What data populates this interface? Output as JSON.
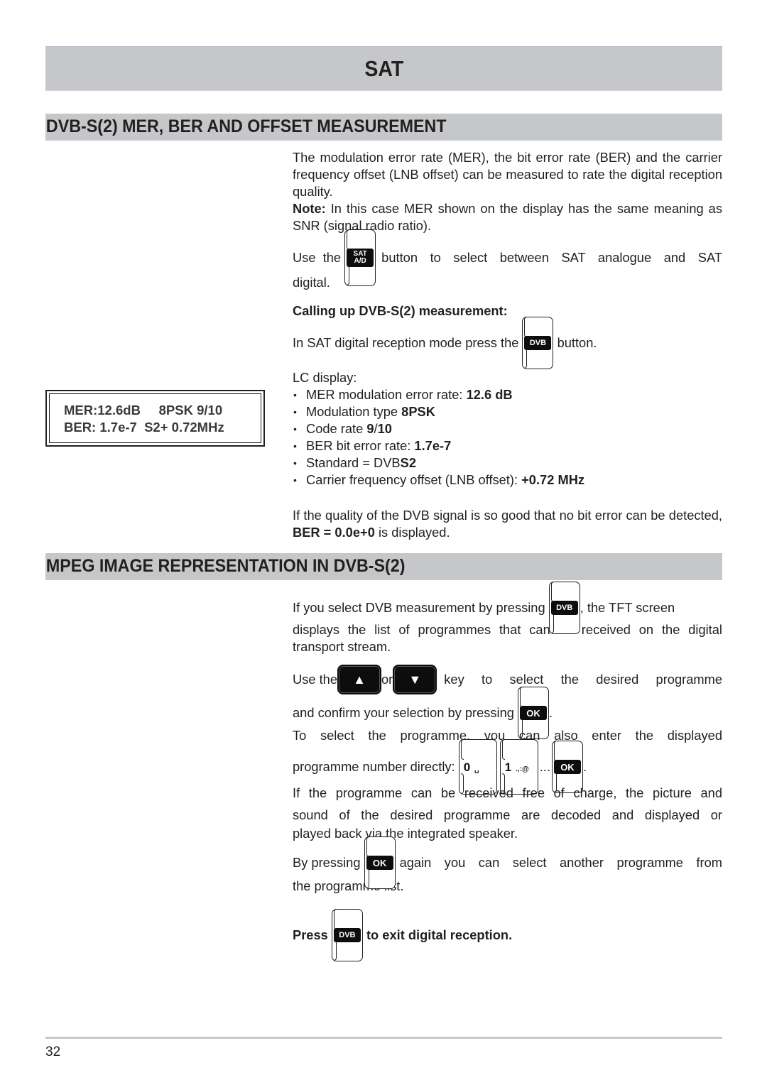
{
  "chapter": {
    "title": "SAT"
  },
  "section1": {
    "title": "DVB-S(2) MER, BER AND OFFSET MEASUREMENT",
    "intro": "The modulation error rate (MER), the bit error rate (BER) and the carrier frequency offset (LNB offset) can be measured to rate the digital reception quality.",
    "note_label": "Note:",
    "note_text": " In this case MER shown on the display has the same meaning as SNR (signal radio ratio).",
    "use_before": "Use the ",
    "use_after": " button to select between SAT analogue and SAT digital.",
    "calling_heading": "Calling up DVB-S(2) measurement:",
    "press_before": "In SAT digital reception mode press the ",
    "press_after": " button.",
    "lc_label": "LC display:",
    "bullets": [
      {
        "text": "MER modulation error rate: ",
        "bold": "12.6 dB",
        "tail": ""
      },
      {
        "text": "Modulation type ",
        "bold": "8PSK",
        "tail": ""
      },
      {
        "text": "Code rate ",
        "bold": "9",
        "tail": "/",
        "bold2": "10"
      },
      {
        "text": "BER bit error rate: ",
        "bold": "1.7e-7",
        "tail": ""
      },
      {
        "text": "Standard = DVB",
        "bold": "S2",
        "tail": ""
      },
      {
        "text": "Carrier frequency offset (LNB offset): ",
        "bold": "+0.72 MHz",
        "tail": ""
      }
    ],
    "no_error_before": "If the quality of the DVB signal is so good that no bit error can be detected, ",
    "no_error_bold": "BER = 0.0e+0",
    "no_error_after": " is displayed."
  },
  "lcd": {
    "row1": "MER:12.6dB     8PSK 9/10",
    "row2": "BER: 1.7e-7  S2+ 0.72MHz"
  },
  "section2": {
    "title": "MPEG IMAGE REPRESENTATION IN DVB-S(2)",
    "p1_before": "If you select DVB measurement by pressing ",
    "p1_after": ", the TFT screen",
    "p1_line2": "displays the list of programmes that can be received on the digital",
    "p1_line3": "transport stream.",
    "p2_use": "Use the",
    "p2_or": "or",
    "p2_after": "key to select the desired programme",
    "p2_confirm": "and confirm your selection by pressing ",
    "p2_end": ".",
    "p3_line1": "To select the programme, you can also enter the displayed",
    "p3_before": "programme number directly: ",
    "p3_ellipsis": "...",
    "p3_end": ".",
    "p4_line1": "If the programme can be received free of charge, the picture and",
    "p4_line2": "sound of the desired programme are decoded and displayed or",
    "p4_line3": "played back via the integrated speaker.",
    "p5_before": "By pressing ",
    "p5_after": " again you can select another programme from",
    "p5_line2": "the programme list.",
    "p6_before": "Press ",
    "p6_after": " to exit digital reception."
  },
  "keys": {
    "sat_line1": "SAT",
    "sat_line2": "A/D",
    "dvb": "DVB",
    "ok": "OK",
    "up": "▲",
    "down": "▼",
    "zero": "0",
    "zero_sub": "␣",
    "one": "1",
    "one_sub": ".,:@"
  },
  "footer": {
    "page_number": "32"
  }
}
